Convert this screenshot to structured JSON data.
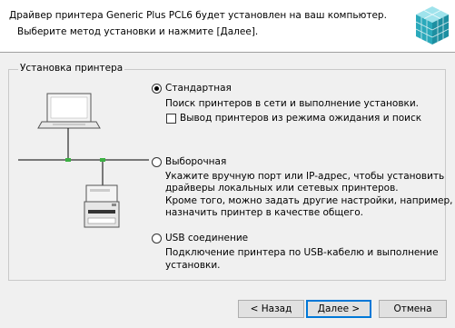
{
  "header": {
    "line1": "Драйвер принтера Generic Plus PCL6 будет установлен на ваш компьютер.",
    "line2": "Выберите метод установки и нажмите [Далее]."
  },
  "group": {
    "title": "Установка принтера"
  },
  "options": [
    {
      "label": "Стандартная",
      "selected": true,
      "description": [
        "Поиск принтеров в сети и выполнение установки."
      ],
      "checkbox": {
        "label": "Вывод принтеров из режима ожидания и поиск",
        "checked": false
      }
    },
    {
      "label": "Выборочная",
      "selected": false,
      "description": [
        "Укажите вручную порт или IP-адрес, чтобы установить",
        "драйверы локальных или сетевых принтеров.",
        "Кроме того, можно задать другие настройки, например,",
        "назначить принтер в качестве общего."
      ]
    },
    {
      "label": "USB соединение",
      "selected": false,
      "description": [
        "Подключение принтера по USB-кабелю и выполнение",
        "установки."
      ]
    }
  ],
  "buttons": {
    "back": "< Назад",
    "next": "Далее >",
    "cancel": "Отмена"
  },
  "colors": {
    "header_bg": "#ffffff",
    "dialog_bg": "#f0f0f0",
    "accent": "#0078d7",
    "logo_teal": "#35b7c6",
    "network_green": "#3cb043"
  }
}
